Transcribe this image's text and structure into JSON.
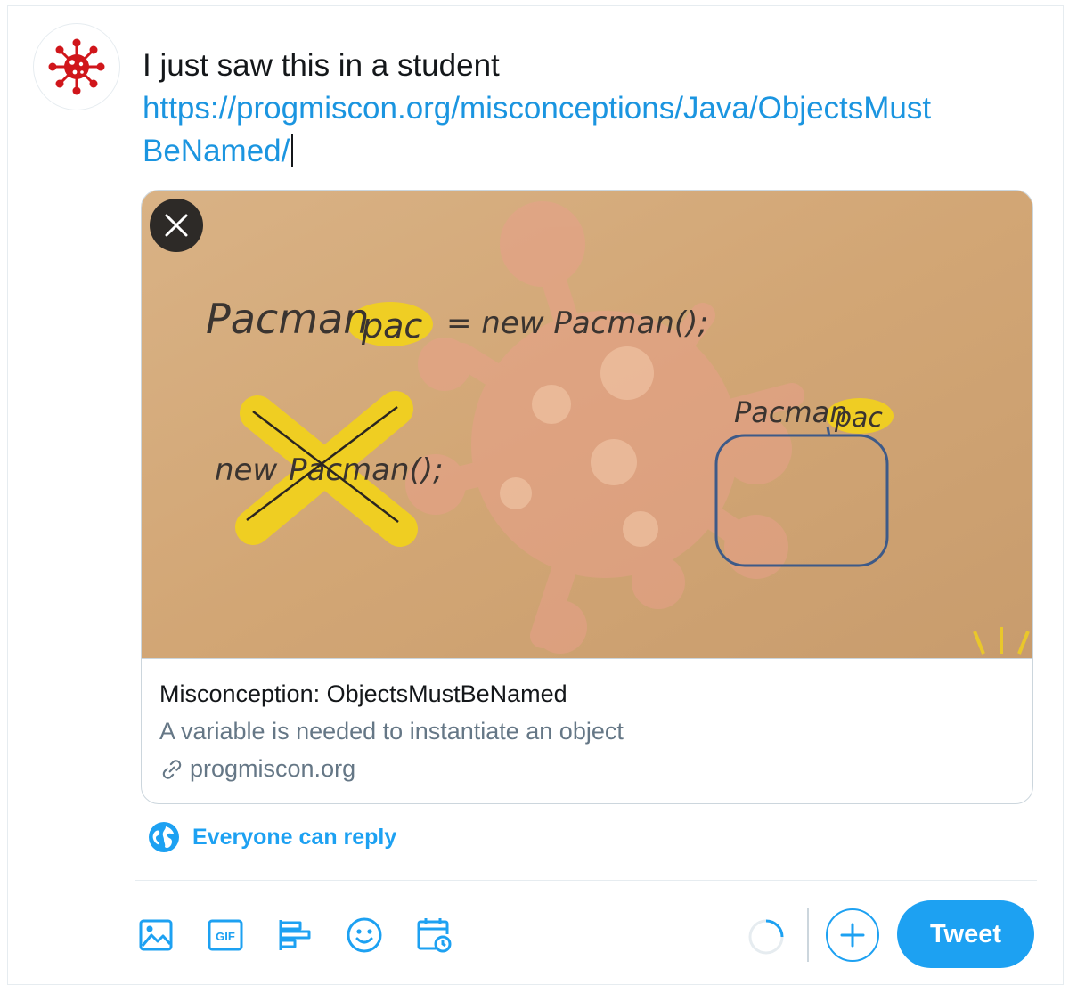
{
  "composer": {
    "text": "I just saw this in a student",
    "url_line1": "https://progmiscon.org/misconceptions/Java/ObjectsMust",
    "url_line2": "BeNamed/"
  },
  "link_card": {
    "title": "Misconception: ObjectsMustBeNamed",
    "description": "A variable is needed to instantiate an object",
    "domain": "progmiscon.org",
    "image_text": {
      "line1_type": "Pacman",
      "line1_var": "pac",
      "line1_rest": "= new Pacman();",
      "crossed_new": "new",
      "crossed_class": "Pacman();",
      "box_type": "Pacman",
      "box_var": "pac"
    }
  },
  "reply_setting": {
    "label": "Everyone can reply"
  },
  "toolbar": {
    "icons": [
      "image-icon",
      "gif-icon",
      "poll-icon",
      "emoji-icon",
      "schedule-icon"
    ],
    "gif_label": "GIF",
    "tweet_label": "Tweet"
  },
  "colors": {
    "accent": "#1da1f2",
    "link": "#1b95e0",
    "avatar_red": "#d0161b",
    "highlight_yellow": "#f2d21b"
  }
}
